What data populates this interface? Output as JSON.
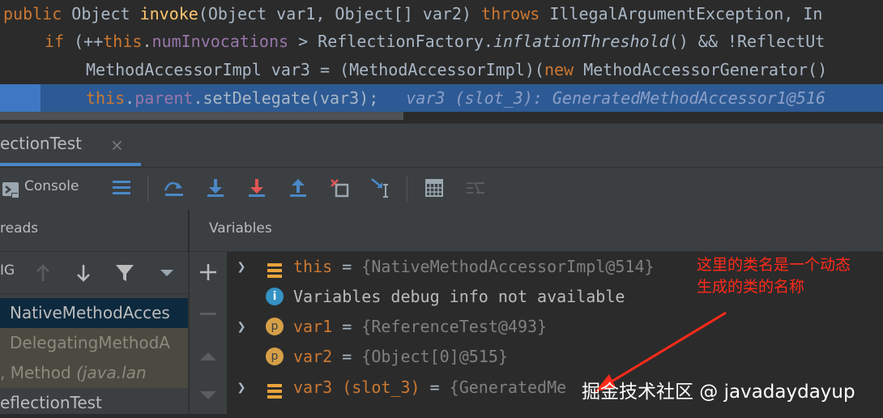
{
  "editor": {
    "line1": {
      "kw_public": "public",
      "type_obj": " Object ",
      "method": "invoke",
      "params": "(Object var1, Object[] var2) ",
      "kw_throws": "throws",
      "exc": " IllegalArgumentException, In"
    },
    "line2": {
      "kw_if": "if",
      "open": " (++",
      "kw_this": "this",
      "dot": ".",
      "field": "numInvocations",
      "cmp": " > ReflectionFactory.",
      "static_m": "inflationThreshold",
      "rest": "() && !ReflectUt"
    },
    "line3": {
      "decl": "MethodAccessorImpl var3 = (MethodAccessorImpl)(",
      "kw_new": "new",
      "rest": " MethodAccessorGenerator()"
    },
    "line4": {
      "kw_this": "this",
      "dot": ".",
      "field": "parent",
      "call": ".setDelegate(var3);",
      "inline_value": "var3 (slot_3): GeneratedMethodAccessor1@516"
    }
  },
  "debug_tab": {
    "title": "ectionTest",
    "close": "×"
  },
  "toolbar": {
    "console_label": "Console"
  },
  "threads": {
    "title": "reads",
    "thread_label": "IG",
    "frames": [
      {
        "text": "NativeMethodAcces",
        "selected": true
      },
      {
        "text": "DelegatingMethodA",
        "selected": false
      },
      {
        "text_a": ", Method ",
        "text_b": "(java.lan",
        "selected": false
      },
      {
        "text": "eflectionTest",
        "selected": false
      }
    ]
  },
  "variables": {
    "title": "Variables",
    "rows": [
      {
        "name": "this",
        "eq": " = ",
        "value": "{NativeMethodAccessorImpl@514}",
        "icon": "field-list-icon",
        "expandable": true
      },
      {
        "name": "",
        "eq": "",
        "value": "Variables debug info not available",
        "icon": "info-icon",
        "expandable": false
      },
      {
        "name": "var1",
        "eq": " = ",
        "value": "{ReferenceTest@493}",
        "icon": "parameter-icon",
        "icon_letter": "p",
        "expandable": true
      },
      {
        "name": "var2",
        "eq": " = ",
        "value": "{Object[0]@515}",
        "icon": "parameter-icon",
        "icon_letter": "p",
        "expandable": false
      },
      {
        "name": "var3 (slot_3)",
        "eq": " = ",
        "value": "{GeneratedMe",
        "icon": "field-list-icon",
        "expandable": true
      }
    ]
  },
  "annotation": {
    "line1": "这里的类名是一个动态",
    "line2": "生成的类的名称"
  },
  "watermark": "掘金技术社区 @ javadaydayup",
  "colors": {
    "selection": "#2d5a94",
    "accent": "#4a88c7",
    "annotation": "#ff2a1a",
    "keyword": "#cc7832"
  }
}
